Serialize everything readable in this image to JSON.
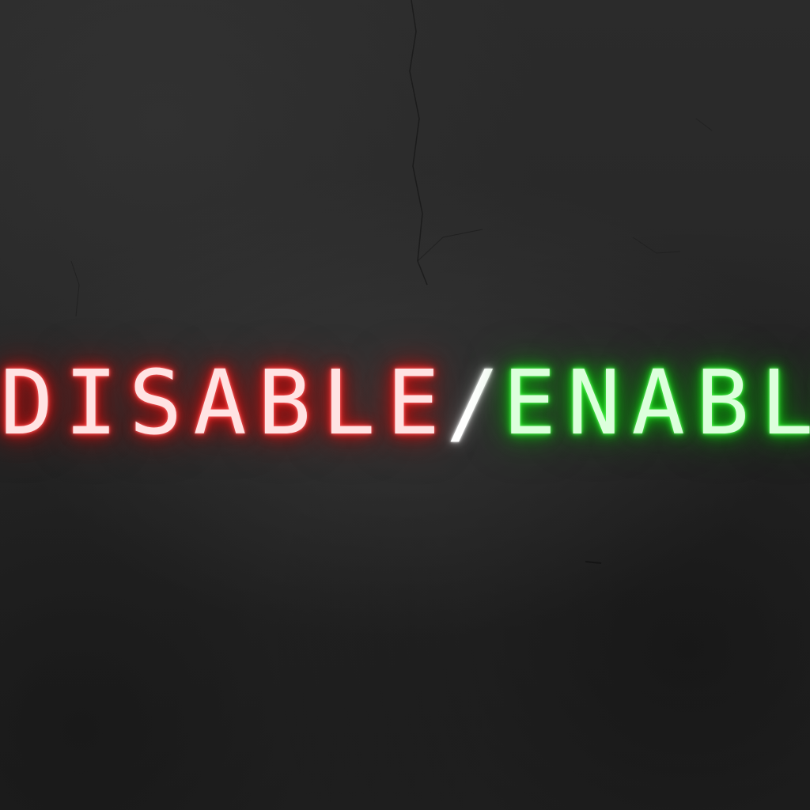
{
  "sign": {
    "disable_text": "DISABLE",
    "slash_text": "/",
    "enable_text": "ENABLE"
  },
  "colors": {
    "background": "#262626",
    "disable_glow": "#e01818",
    "disable_core": "#ffe3e3",
    "slash": "#ffffff",
    "enable_glow": "#12c812",
    "enable_core": "#dcffdc"
  }
}
